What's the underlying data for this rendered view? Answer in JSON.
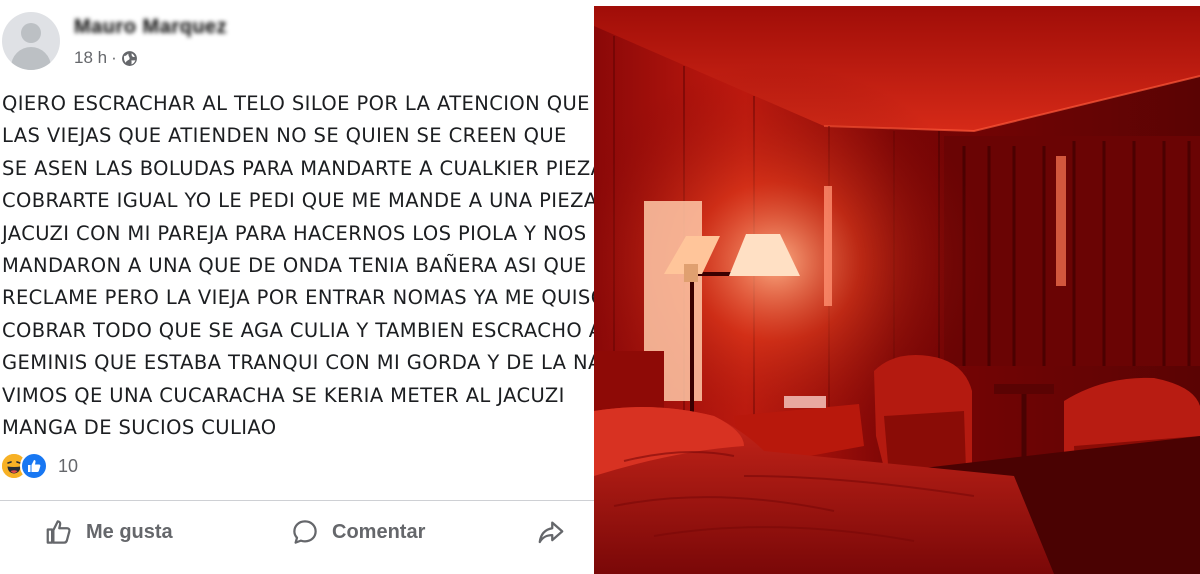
{
  "post": {
    "author": "Mauro Marquez",
    "time": "18 h",
    "separator": "·",
    "lines": [
      "QIERO ESCRACHAR AL TELO SILOE POR LA ATENCION QUE",
      "LAS VIEJAS QUE ATIENDEN NO SE QUIEN SE CREEN QUE",
      "SE ASEN LAS BOLUDAS PARA MANDARTE A CUALKIER PIEZA",
      "COBRARTE IGUAL YO LE PEDI QUE ME MANDE A UNA PIEZA",
      "JACUZI CON MI PAREJA PARA HACERNOS LOS PIOLA Y NOS",
      "MANDARON A UNA QUE DE ONDA TENIA BAÑERA ASI QUE",
      "RECLAME PERO LA VIEJA POR ENTRAR NOMAS YA ME QUISO",
      "COBRAR TODO QUE SE AGA CULIA Y TAMBIEN ESCRACHO AL",
      "GEMINIS QUE ESTABA TRANQUI CON MI GORDA Y DE LA NADA",
      "VIMOS QE UNA CUCARACHA SE KERIA METER AL JACUZI",
      "MANGA DE SUCIOS CULIAO"
    ],
    "reaction_count": "10",
    "actions": {
      "like": "Me gusta",
      "comment": "Comentar"
    }
  },
  "colors": {
    "text": "#1c1e21",
    "muted": "#65676b",
    "like_blue": "#1877f2",
    "haha_yellow": "#f7b125",
    "photo_red": "#b01010"
  },
  "icons": [
    "globe-icon",
    "haha-icon",
    "like-react-icon",
    "like-icon",
    "comment-icon",
    "share-icon"
  ]
}
